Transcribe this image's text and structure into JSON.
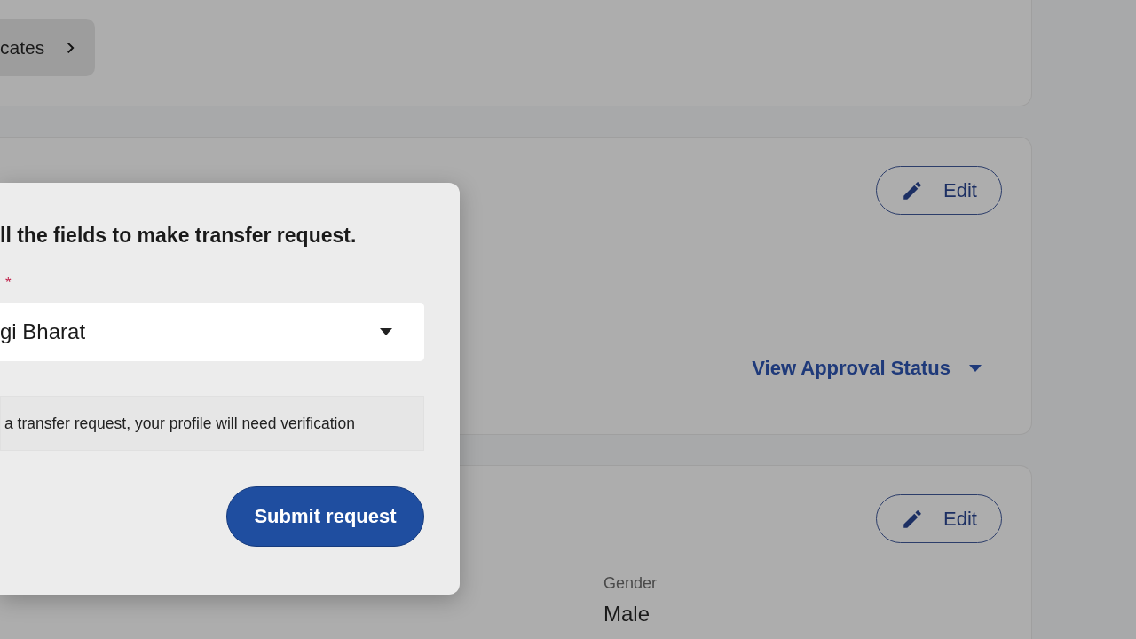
{
  "certificates_button": {
    "label": "cates"
  },
  "approval_card": {
    "edit_label": "Edit",
    "approval_status": {
      "label": "View Approval Status",
      "expanded": false
    }
  },
  "details_card": {
    "edit_label": "Edit",
    "fields": [
      {
        "label": "Gender",
        "value": "Male"
      }
    ]
  },
  "transfer_dialog": {
    "instruction": "ll the fields to make transfer request.",
    "required_mark": "*",
    "select_value": "gi Bharat",
    "notice": "a transfer request, your profile will need verification",
    "submit_label": "Submit request"
  }
}
